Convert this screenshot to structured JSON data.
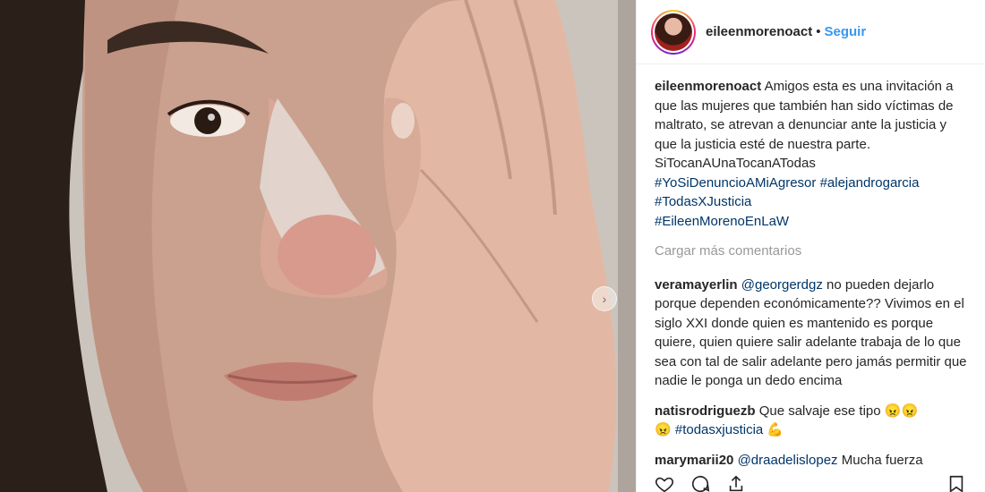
{
  "post": {
    "username": "eileenmorenoact",
    "dot": "•",
    "follow_label": "Seguir",
    "carousel_next_glyph": "›",
    "caption": {
      "username": "eileenmorenoact",
      "text": "Amigos esta es una invitación a que las mujeres que también han sido víctimas de maltrato, se atrevan a denunciar ante la justicia y que la justicia esté de nuestra parte. SiTocanAUnaTocanATodas",
      "hashtag_1": "#YoSiDenuncioAMiAgresor",
      "hashtag_2": "#alejandrogarcia",
      "hashtag_3": "#TodasXJusticia",
      "hashtag_4": "#EileenMorenoEnLaW"
    },
    "load_more_label": "Cargar más comentarios",
    "comments": [
      {
        "username": "veramayerlin",
        "mention": "@georgerdgz",
        "text": "no pueden dejarlo porque dependen económicamente?? Vivimos en el siglo XXI donde quien es mantenido es porque quiere, quien quiere salir adelante trabaja de lo que sea con tal de salir adelante pero jamás permitir que nadie le ponga un dedo encima"
      },
      {
        "username": "natisrodriguezb",
        "text": "Que salvaje ese tipo",
        "emoji_a": "😠😠",
        "emoji_b": "😠",
        "hashtag": "#todasxjusticia",
        "emoji_c": "💪"
      },
      {
        "username": "marymarii20",
        "mention": "@draadelislopez",
        "text": "Mucha fuerza"
      }
    ]
  },
  "colors": {
    "link_blue": "#3897f0",
    "hashtag_blue": "#003569",
    "muted_gray": "#999999",
    "text_dark": "#262626"
  },
  "icons": [
    "heart-icon",
    "comment-icon",
    "share-icon",
    "bookmark-icon",
    "chevron-right-icon"
  ]
}
